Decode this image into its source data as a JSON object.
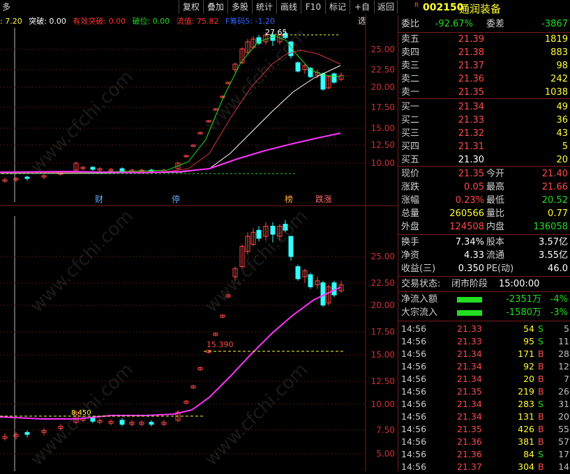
{
  "toolbar": {
    "nav_left": "多",
    "items": [
      "复权",
      "叠加",
      "多股",
      "统计",
      "画线",
      "F10",
      "标记",
      "+自选",
      "返回"
    ]
  },
  "indicators": {
    "first": ": 7.20",
    "tupo": "突破: 0.00",
    "youxiao": "有效突破: 0.00",
    "powei": "破位: 0.00",
    "liuzhi": "流值: 75.82",
    "chouma": "F筹码5: -1.20"
  },
  "stock": {
    "badge": "R",
    "code": "002150",
    "name": "通润装备"
  },
  "weibi": {
    "label": "委比",
    "value": "-92.67%",
    "label2": "委差",
    "value2": "-3867"
  },
  "asks": [
    {
      "label": "卖五",
      "price": "21.39",
      "vol": "1819"
    },
    {
      "label": "卖四",
      "price": "21.38",
      "vol": "883"
    },
    {
      "label": "卖三",
      "price": "21.37",
      "vol": "98"
    },
    {
      "label": "卖二",
      "price": "21.36",
      "vol": "242"
    },
    {
      "label": "卖一",
      "price": "21.35",
      "vol": "1038"
    }
  ],
  "bids": [
    {
      "label": "买一",
      "price": "21.34",
      "vol": "49"
    },
    {
      "label": "买二",
      "price": "21.33",
      "vol": "36"
    },
    {
      "label": "买三",
      "price": "21.32",
      "vol": "43"
    },
    {
      "label": "买四",
      "price": "21.31",
      "vol": "5"
    },
    {
      "label": "买五",
      "price": "21.30",
      "vol": "20"
    }
  ],
  "quote": [
    {
      "l1": "现价",
      "v1": "21.35",
      "c1": "red",
      "l2": "今开",
      "v2": "21.40",
      "c2": "red"
    },
    {
      "l1": "涨跌",
      "v1": "0.05",
      "c1": "red",
      "l2": "最高",
      "v2": "21.66",
      "c2": "red"
    },
    {
      "l1": "涨幅",
      "v1": "0.23%",
      "c1": "red",
      "l2": "最低",
      "v2": "20.52",
      "c2": "green"
    },
    {
      "l1": "总量",
      "v1": "260566",
      "c1": "yellow",
      "l2": "量比",
      "v2": "0.77",
      "c2": "yellow"
    },
    {
      "l1": "外盘",
      "v1": "124508",
      "c1": "red",
      "l2": "内盘",
      "v2": "136058",
      "c2": "green"
    }
  ],
  "fundamentals": [
    {
      "l1": "换手",
      "v1": "7.34%",
      "l2": "股本",
      "v2": "3.57亿"
    },
    {
      "l1": "净资",
      "v1": "4.33",
      "l2": "流通",
      "v2": "3.55亿"
    },
    {
      "l1": "收益(三)",
      "v1": "0.350",
      "l2": "PE(动)",
      "v2": "46.0"
    }
  ],
  "status": {
    "label": "交易状态:",
    "value": "闭市阶段",
    "time": "15:00:00"
  },
  "flows": [
    {
      "label": "净流入额",
      "value": "-2351万",
      "pct": "-4%"
    },
    {
      "label": "大宗流入",
      "value": "-1580万",
      "pct": "-3%"
    }
  ],
  "ticks": [
    {
      "time": "14:56",
      "price": "21.33",
      "vol": "54",
      "side": "S",
      "n": "5"
    },
    {
      "time": "14:56",
      "price": "21.33",
      "vol": "95",
      "side": "S",
      "n": "11"
    },
    {
      "time": "14:56",
      "price": "21.34",
      "vol": "171",
      "side": "B",
      "n": "28"
    },
    {
      "time": "14:56",
      "price": "21.34",
      "vol": "92",
      "side": "B",
      "n": "12"
    },
    {
      "time": "14:56",
      "price": "21.34",
      "vol": "20",
      "side": "B",
      "n": "7"
    },
    {
      "time": "14:56",
      "price": "21.35",
      "vol": "219",
      "side": "B",
      "n": "26"
    },
    {
      "time": "14:56",
      "price": "21.34",
      "vol": "283",
      "side": "S",
      "n": "31"
    },
    {
      "time": "14:56",
      "price": "21.34",
      "vol": "131",
      "side": "B",
      "n": "20"
    },
    {
      "time": "14:56",
      "price": "21.35",
      "vol": "426",
      "side": "B",
      "n": "55"
    },
    {
      "time": "14:56",
      "price": "21.36",
      "vol": "381",
      "side": "B",
      "n": "57"
    },
    {
      "time": "14:56",
      "price": "21.36",
      "vol": "84",
      "side": "S",
      "n": "17"
    },
    {
      "time": "14:56",
      "price": "21.37",
      "vol": "304",
      "side": "B",
      "n": "14"
    }
  ],
  "chart_labels": {
    "top_max": "27.65",
    "top_axis": [
      "25.00",
      "22.50",
      "20.00",
      "17.50",
      "15.00",
      "12.50",
      "10.00"
    ],
    "bottom_axis": [
      "25.00",
      "22.50",
      "20.00",
      "17.50",
      "15.00",
      "12.50",
      "10.00",
      "7.50",
      "5.00"
    ],
    "annotation": "15.390",
    "low_label": "8.450",
    "events": [
      "财",
      "停",
      "榜",
      "跌涨"
    ]
  },
  "watermark": "www.cfchi.com",
  "colors": {
    "up": "#ff4a4a",
    "down": "#33ffff",
    "ma_purple": "#ff33ff",
    "green": "#22dd22"
  }
}
